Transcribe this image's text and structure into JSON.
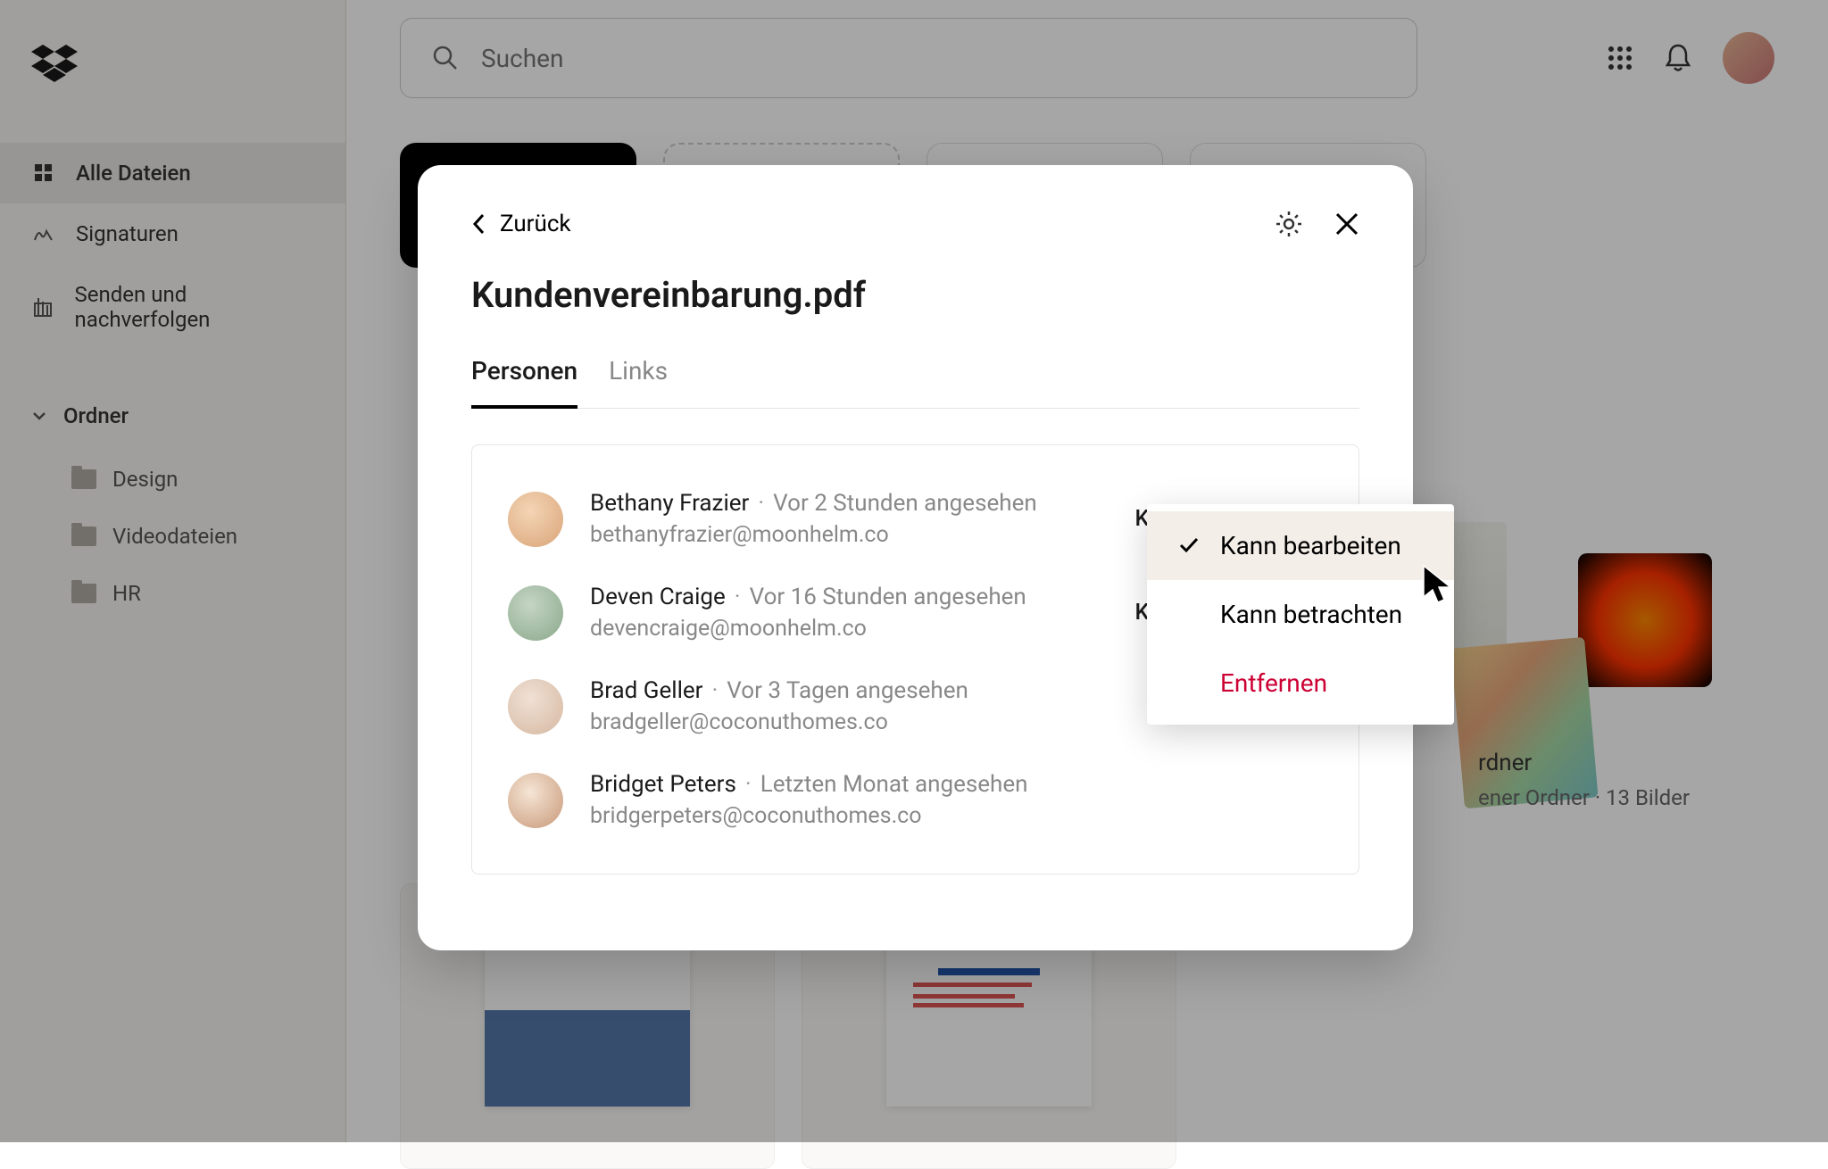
{
  "search": {
    "placeholder": "Suchen"
  },
  "sidebar": {
    "items": [
      {
        "label": "Alle Dateien",
        "active": true
      },
      {
        "label": "Signaturen",
        "active": false
      },
      {
        "label": "Senden und nachverfolgen",
        "active": false
      }
    ],
    "folders_header": "Ordner",
    "folders": [
      {
        "label": "Design"
      },
      {
        "label": "Videodateien"
      },
      {
        "label": "HR"
      }
    ]
  },
  "modal": {
    "back_label": "Zurück",
    "title": "Kundenvereinbarung.pdf",
    "tabs": {
      "people": "Personen",
      "links": "Links"
    },
    "permission_label": "Kann  bearbeiten",
    "people": [
      {
        "name": "Bethany Frazier",
        "meta": "Vor 2 Stunden angesehen",
        "email": "bethanyfrazier@moonhelm.co"
      },
      {
        "name": "Deven Craige",
        "meta": "Vor 16 Stunden angesehen",
        "email": "devencraige@moonhelm.co"
      },
      {
        "name": "Brad Geller",
        "meta": "Vor 3 Tagen angesehen",
        "email": "bradgeller@coconuthomes.co"
      },
      {
        "name": "Bridget Peters",
        "meta": "Letzten Monat angesehen",
        "email": "bridgerpeters@coconuthomes.co"
      }
    ]
  },
  "dropdown": {
    "edit": "Kann bearbeiten",
    "view": "Kann betrachten",
    "remove": "Entfernen"
  },
  "folder_card": {
    "line1": "rdner",
    "line2": "ener Ordner · 13 Bilder"
  }
}
